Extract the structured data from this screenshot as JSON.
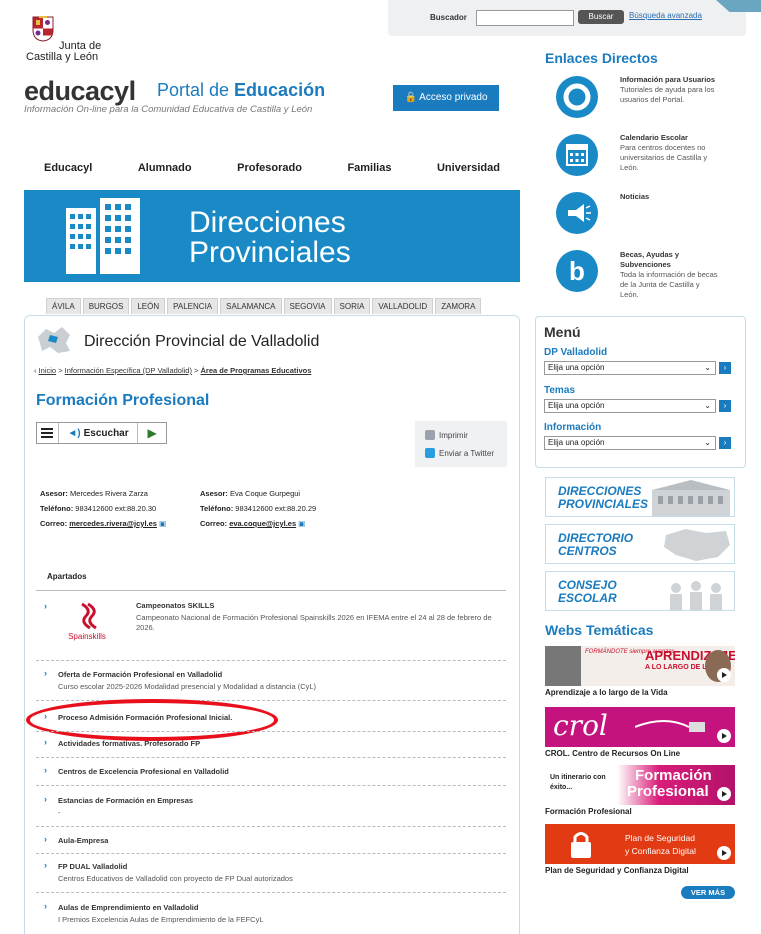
{
  "search": {
    "label": "Buscador",
    "value": "",
    "button": "Buscar",
    "advanced": "Búsqueda avanzada"
  },
  "brand": {
    "junta_line1": "Junta de",
    "junta_line2": "Castilla y León",
    "site": "educacyl",
    "portal_pre": "Portal de ",
    "portal_bold": "Educación",
    "tagline": "Información On-line para la Comunidad Educativa de Castilla y León",
    "access": "Acceso privado"
  },
  "nav": [
    "Educacyl",
    "Alumnado",
    "Profesorado",
    "Familias",
    "Universidad"
  ],
  "banner": {
    "line1": "Direcciones",
    "line2": "Provinciales"
  },
  "provinces": [
    "ÁVILA",
    "BURGOS",
    "LEÓN",
    "PALENCIA",
    "SALAMANCA",
    "SEGOVIA",
    "SORIA",
    "VALLADOLID",
    "ZAMORA"
  ],
  "page": {
    "dp_title": "Dirección Provincial de Valladolid",
    "crumb_home": "Inicio",
    "crumb_sep": " > ",
    "crumb_info": "Información Específica (DP Valladolid)",
    "crumb_area": "Área de Programas Educativos",
    "title": "Formación Profesional",
    "listen": "Escuchar",
    "print": "Imprimir",
    "twitter": "Enviar a Twitter"
  },
  "advisors": [
    {
      "asesor_lbl": "Asesor:",
      "name": "Mercedes Rivera Zarza",
      "tel_lbl": "Teléfono:",
      "tel": "983412600 ext:88.20.30",
      "mail_lbl": "Correo:",
      "mail": "mercedes.rivera@jcyl.es"
    },
    {
      "asesor_lbl": "Asesor:",
      "name": "Eva Coque Gurpegui",
      "tel_lbl": "Teléfono:",
      "tel": "983412600 ext:88.20.29",
      "mail_lbl": "Correo:",
      "mail": "eva.coque@jcyl.es"
    }
  ],
  "apartados_title": "Apartados",
  "apartados": [
    {
      "title": "Campeonatos SKILLS",
      "desc": "Campeonato Nacional de Formación Profesional Spainskills 2026 en IFEMA entre el 24 al 28 de febrero de 2026.",
      "logo": "Spainskills"
    },
    {
      "title": "Oferta de Formación Profesional en Valladolid",
      "desc": "Curso escolar 2025-2026 Modalidad presencial y Modalidad a distancia (CyL)"
    },
    {
      "title": "Proceso Admisión Formación Profesional Inicial.",
      "desc": ""
    },
    {
      "title": "Actividades formativas. Profesorado FP",
      "desc": ""
    },
    {
      "title": "Centros de Excelencia Profesional en Valladolid",
      "desc": ""
    },
    {
      "title": "Estancias de Formación en Empresas",
      "desc": "-"
    },
    {
      "title": "Aula-Empresa",
      "desc": ""
    },
    {
      "title": "FP DUAL Valladolid",
      "desc": "Centros Educativos de Valladolid con proyecto de FP Dual autorizados"
    },
    {
      "title": "Aulas de Emprendimiento en Valladolid",
      "desc": "I Premios Excelencia Aulas de Emprendimiento de la FEFCyL"
    }
  ],
  "enlaces": {
    "title": "Enlaces Directos",
    "items": [
      {
        "title": "Información para Usuarios",
        "desc": "Tutoriales de ayuda para los usuarios del Portal."
      },
      {
        "title": "Calendario Escolar",
        "desc": "Para centros docentes no universitarios de Castilla y León."
      },
      {
        "title": "Noticias",
        "desc": ""
      },
      {
        "title": "Becas, Ayudas y Subvenciones",
        "desc": "Toda la información de becas de la Junta de Castilla y León."
      }
    ]
  },
  "menu": {
    "title": "Menú",
    "sections": [
      {
        "label": "DP Valladolid",
        "select": "Elija una opción"
      },
      {
        "label": "Temas",
        "select": "Elija una opción"
      },
      {
        "label": "Información",
        "select": "Elija una opción"
      }
    ]
  },
  "promos": [
    {
      "l1": "DIRECCIONES",
      "l2": "PROVINCIALES"
    },
    {
      "l1": "DIRECTORIO",
      "l2": "CENTROS"
    },
    {
      "l1": "CONSEJO",
      "l2": "ESCOLAR"
    }
  ],
  "webs": {
    "title": "Webs Temáticas",
    "items": [
      {
        "label": "Aprendizaje a lo largo de la Vida",
        "img1": "APRENDIZAJE",
        "img2": "A LO LARGO DE LA VIDA",
        "img0": "FORMÁNDOTE siempre avanzas"
      },
      {
        "label": "CROL. Centro de Recursos On Line",
        "img1": "crol"
      },
      {
        "label": "Formación Profesional",
        "img1": "Formación",
        "img2": "Profesional",
        "img0": "Un itinerario con éxito..."
      },
      {
        "label": "Plan de Seguridad y Confianza Digital",
        "img1": "Plan de Seguridad",
        "img2": "y Confianza Digital"
      }
    ],
    "more": "VER MÁS"
  }
}
